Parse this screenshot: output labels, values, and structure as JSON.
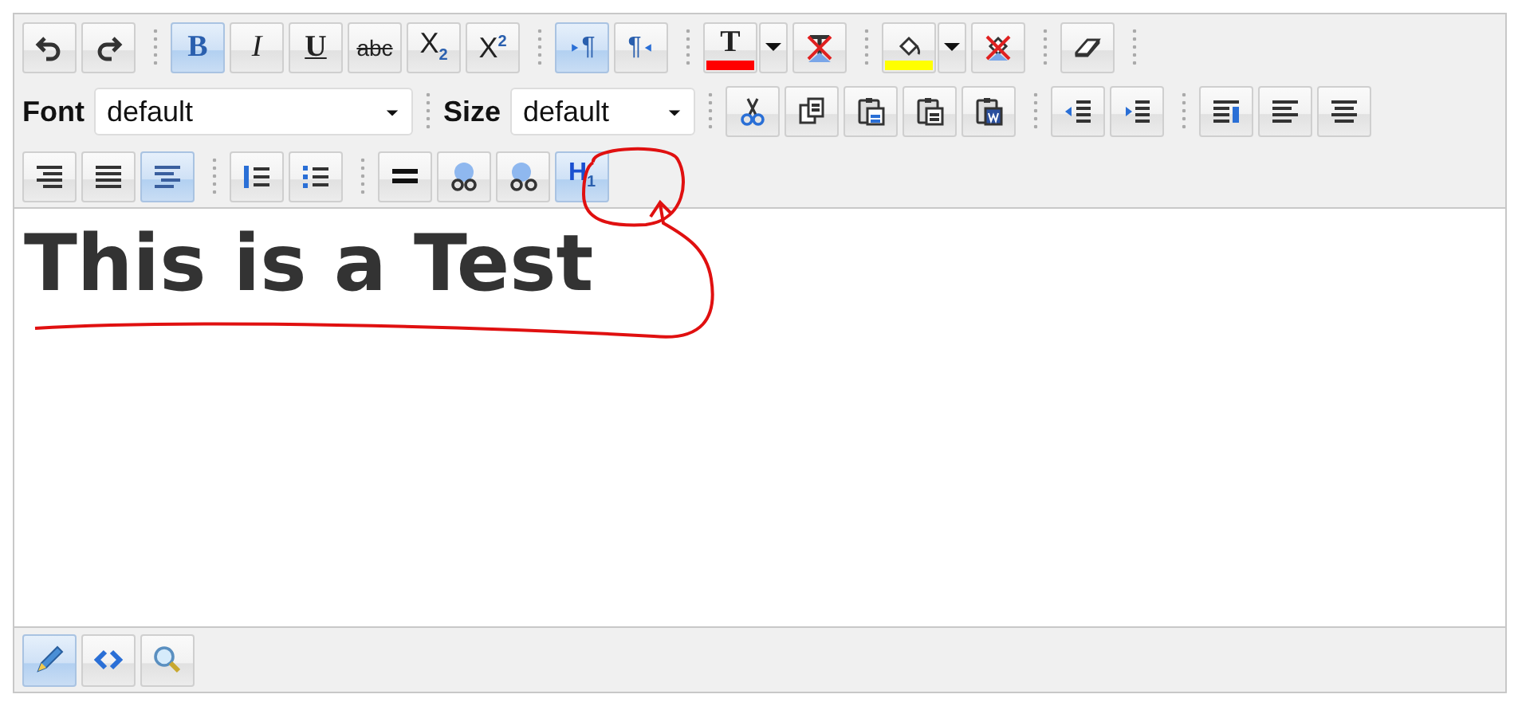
{
  "toolbar": {
    "row_1": [
      {
        "kind": "button",
        "selected": false
      },
      {
        "kind": "button",
        "selected": false
      },
      {
        "kind": "separator"
      },
      {
        "kind": "button",
        "label": "B",
        "selected": true
      },
      {
        "kind": "button",
        "label": "I",
        "selected": false
      },
      {
        "kind": "button",
        "label": "U",
        "selected": false
      },
      {
        "kind": "button",
        "label": "abc",
        "selected": false
      },
      {
        "kind": "button",
        "label": "X$_{2}$",
        "selected": false
      },
      {
        "kind": "button",
        "label": "X$^{2}$",
        "selected": false
      },
      {
        "kind": "separator"
      },
      {
        "kind": "button",
        "label": "¶",
        "selected": true
      },
      {
        "kind": "button",
        "label": "¶",
        "selected": false
      },
      {
        "kind": "separator"
      },
      {
        "kind": "button",
        "label": "T",
        "color": "#ff0000",
        "selected": false
      },
      {
        "kind": "dropdown",
        "selected": false
      },
      {
        "kind": "button",
        "selected": false
      },
      {
        "kind": "separator"
      },
      {
        "kind": "button",
        "color": "#ffff00",
        "selected": false
      },
      {
        "kind": "dropdown",
        "selected": false
      },
      {
        "kind": "button",
        "selected": false
      },
      {
        "kind": "separator"
      },
      {
        "kind": "button",
        "selected": false
      },
      {
        "kind": "separator"
      }
    ],
    "row_2": [
      {
        "kind": "label",
        "text": "Font"
      },
      {
        "kind": "select",
        "value": "default"
      },
      {
        "kind": "separator"
      },
      {
        "kind": "label",
        "text": "Size"
      },
      {
        "kind": "select",
        "value": "default"
      },
      {
        "kind": "separator"
      },
      {
        "kind": "button",
        "selected": false
      },
      {
        "kind": "button",
        "selected": false
      },
      {
        "kind": "button",
        "selected": false
      },
      {
        "kind": "button",
        "selected": false
      },
      {
        "kind": "button",
        "selected": false
      },
      {
        "kind": "separator"
      },
      {
        "kind": "button",
        "selected": false
      },
      {
        "kind": "button",
        "selected": false
      },
      {
        "kind": "separator"
      },
      {
        "kind": "button",
        "selected": false
      },
      {
        "kind": "button",
        "selected": false
      },
      {
        "kind": "button",
        "selected": false
      }
    ],
    "row_3": [
      {
        "kind": "button",
        "selected": false
      },
      {
        "kind": "button",
        "selected": false
      },
      {
        "kind": "button",
        "selected": true
      },
      {
        "kind": "separator"
      },
      {
        "kind": "button",
        "selected": false
      },
      {
        "kind": "button",
        "selected": false
      },
      {
        "kind": "separator"
      },
      {
        "kind": "button",
        "selected": false
      },
      {
        "kind": "button",
        "selected": false
      },
      {
        "kind": "button",
        "selected": false
      },
      {
        "kind": "button",
        "label": "H$_{1}$",
        "selected": true
      }
    ]
  },
  "content": {
    "heading": "This is a Test"
  },
  "mode_bar": {
    "buttons": [
      {
        "selected": true
      },
      {
        "selected": false
      },
      {
        "selected": false
      }
    ]
  }
}
